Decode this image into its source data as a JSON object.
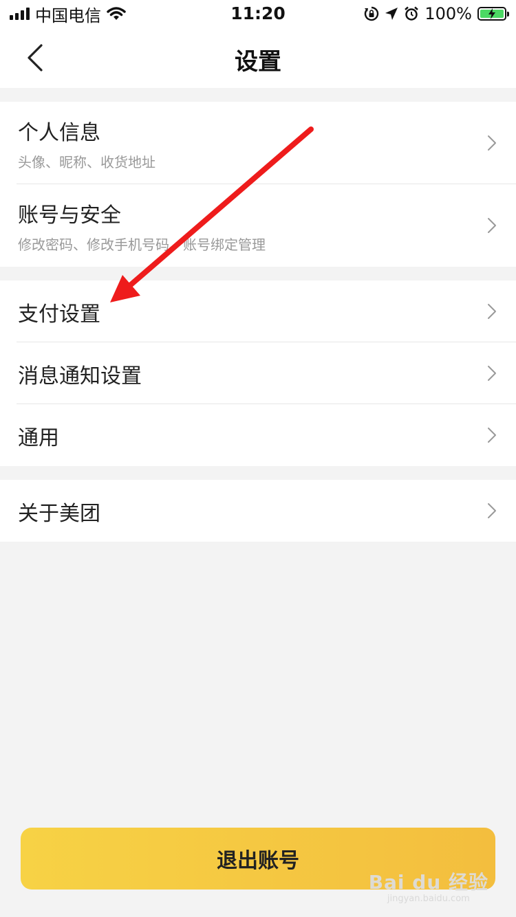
{
  "status_bar": {
    "carrier": "中国电信",
    "time": "11:20",
    "battery": "100%",
    "icons": [
      "signal-icon",
      "wifi-icon",
      "rotation-lock-icon",
      "location-icon",
      "alarm-icon",
      "battery-charging-icon"
    ]
  },
  "nav": {
    "title": "设置",
    "back_icon": "back-arrow-icon"
  },
  "groups": [
    {
      "items": [
        {
          "label": "个人信息",
          "sub": "头像、昵称、收货地址"
        },
        {
          "label": "账号与安全",
          "sub": "修改密码、修改手机号码、账号绑定管理"
        }
      ]
    },
    {
      "items": [
        {
          "label": "支付设置"
        },
        {
          "label": "消息通知设置"
        },
        {
          "label": "通用"
        }
      ]
    },
    {
      "items": [
        {
          "label": "关于美团"
        }
      ]
    }
  ],
  "logout": {
    "label": "退出账号"
  },
  "annotation": {
    "arrow_color": "#ee1c1c",
    "points_to": "支付设置"
  },
  "watermark": {
    "main": "Bai du 经验",
    "sub": "jingyan.baidu.com"
  },
  "colors": {
    "background": "#f3f3f3",
    "button_gradient_start": "#f7d245",
    "button_gradient_end": "#f3be3e",
    "battery_fill": "#4cd964"
  }
}
